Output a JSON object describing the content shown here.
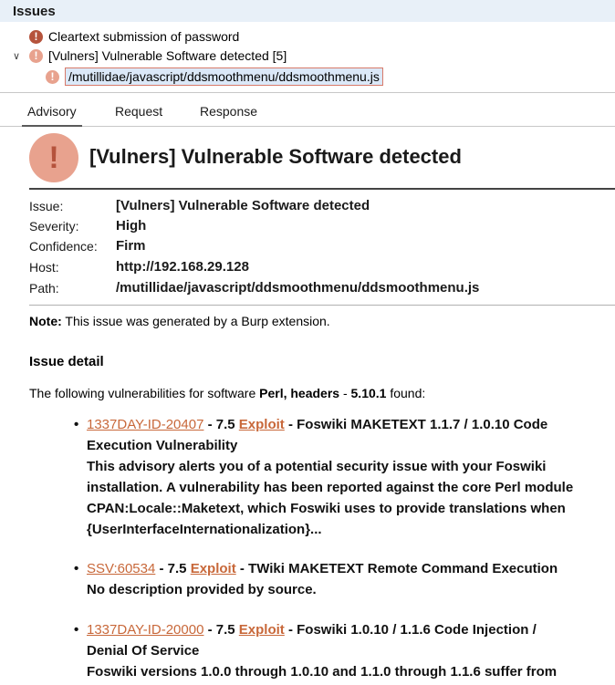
{
  "panel": {
    "title": "Issues"
  },
  "tree": {
    "item1": "Cleartext submission of password",
    "item2": "[Vulners] Vulnerable Software detected [5]",
    "selected_path": "/mutillidae/javascript/ddsmoothmenu/ddsmoothmenu.js"
  },
  "tabs": {
    "advisory": "Advisory",
    "request": "Request",
    "response": "Response"
  },
  "advisory": {
    "heading": "[Vulners] Vulnerable Software detected",
    "props": {
      "issue_label": "Issue:",
      "issue_value": "[Vulners] Vulnerable Software detected",
      "severity_label": "Severity:",
      "severity_value": "High",
      "confidence_label": "Confidence:",
      "confidence_value": "Firm",
      "host_label": "Host:",
      "host_value": "http://192.168.29.128",
      "path_label": "Path:",
      "path_value": "/mutillidae/javascript/ddsmoothmenu/ddsmoothmenu.js"
    },
    "note_label": "Note:",
    "note_text": " This issue was generated by a Burp extension.",
    "detail_title": "Issue detail",
    "intro_pre": "The following vulnerabilities for software ",
    "intro_software": "Perl, headers",
    "intro_mid": " - ",
    "intro_version": "5.10.1",
    "intro_post": " found:",
    "vulns": [
      {
        "id": "1337DAY-ID-20407",
        "score": " - 7.5 ",
        "exploit": "Exploit",
        "title_line1": " - Foswiki MAKETEXT 1.1.7 / 1.0.10 Code",
        "lines": [
          "Execution Vulnerability",
          "This advisory alerts you of a potential security issue with your Foswiki",
          "installation. A vulnerability has been reported against the core Perl module",
          "CPAN:Locale::Maketext, which Foswiki uses to provide translations when",
          "{UserInterfaceInternationalization}..."
        ]
      },
      {
        "id": "SSV:60534",
        "score": " - 7.5 ",
        "exploit": "Exploit",
        "title_line1": " - TWiki MAKETEXT Remote Command Execution",
        "lines": [
          "No description provided by source."
        ]
      },
      {
        "id": "1337DAY-ID-20000",
        "score": " - 7.5 ",
        "exploit": "Exploit",
        "title_line1": " - Foswiki 1.0.10 / 1.1.6 Code Injection /",
        "lines": [
          "Denial Of Service",
          "Foswiki versions 1.0.0 through 1.0.10 and 1.1.0 through 1.1.6 suffer from"
        ]
      }
    ]
  }
}
